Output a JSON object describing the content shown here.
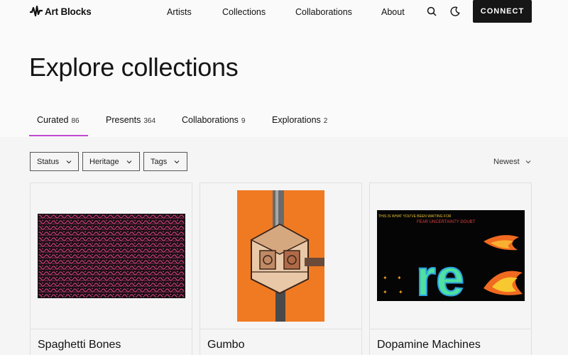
{
  "header": {
    "logo_text": "Art Blocks",
    "nav": [
      "Artists",
      "Collections",
      "Collaborations",
      "About"
    ],
    "connect_label": "CONNECT"
  },
  "page": {
    "title": "Explore collections"
  },
  "tabs": [
    {
      "label": "Curated",
      "count": "86",
      "active": true
    },
    {
      "label": "Presents",
      "count": "364"
    },
    {
      "label": "Collaborations",
      "count": "9"
    },
    {
      "label": "Explorations",
      "count": "2"
    }
  ],
  "filters": [
    "Status",
    "Heritage",
    "Tags"
  ],
  "sort": {
    "label": "Newest"
  },
  "cards": [
    {
      "title": "Spaghetti Bones"
    },
    {
      "title": "Gumbo"
    },
    {
      "title": "Dopamine Machines",
      "art_text_1": "THIS IS WHAT YOU'VE BEEN WAITING FOR",
      "art_text_2": "FEAR UNCERTAINTY DOUBT",
      "art_text_3": "re"
    }
  ],
  "colors": {
    "accent": "#c04ad0",
    "connect_bg": "#161616",
    "gumbo_orange": "#f07a22"
  }
}
